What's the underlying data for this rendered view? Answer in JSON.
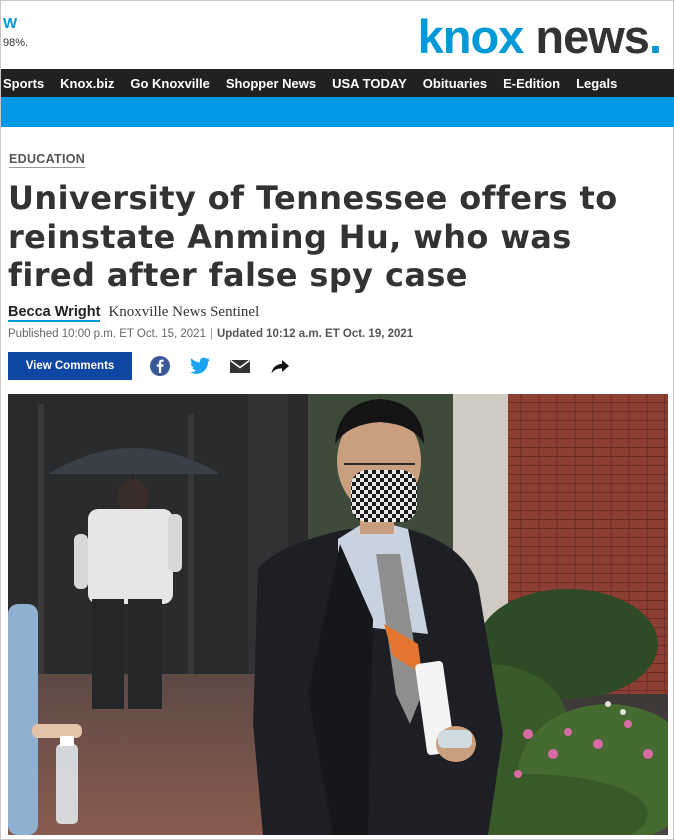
{
  "header": {
    "weather_letter": "W",
    "weather_value": "98%.",
    "logo_part1": "knox",
    "logo_part2": " news",
    "logo_dot": "."
  },
  "nav": {
    "items": [
      {
        "label": "Sports"
      },
      {
        "label": "Knox.biz"
      },
      {
        "label": "Go Knoxville"
      },
      {
        "label": "Shopper News"
      },
      {
        "label": "USA TODAY"
      },
      {
        "label": "Obituaries"
      },
      {
        "label": "E-Edition"
      },
      {
        "label": "Legals"
      }
    ]
  },
  "article": {
    "section": "EDUCATION",
    "headline": "University of Tennessee offers to reinstate Anming Hu, who was fired after false spy case",
    "author": "Becca Wright",
    "publication": "Knoxville News Sentinel",
    "published": "Published 10:00 p.m. ET Oct. 15, 2021",
    "separator": "|",
    "updated": "Updated 10:12 a.m. ET Oct. 19, 2021",
    "view_comments": "View Comments"
  },
  "share_icons": [
    "facebook-icon",
    "twitter-icon",
    "email-icon",
    "share-arrow-icon"
  ],
  "colors": {
    "brand_blue": "#0099d8",
    "nav_bg": "#212121",
    "button_blue": "#0e46a3",
    "facebook": "#3b5998",
    "twitter": "#1da1f2"
  }
}
